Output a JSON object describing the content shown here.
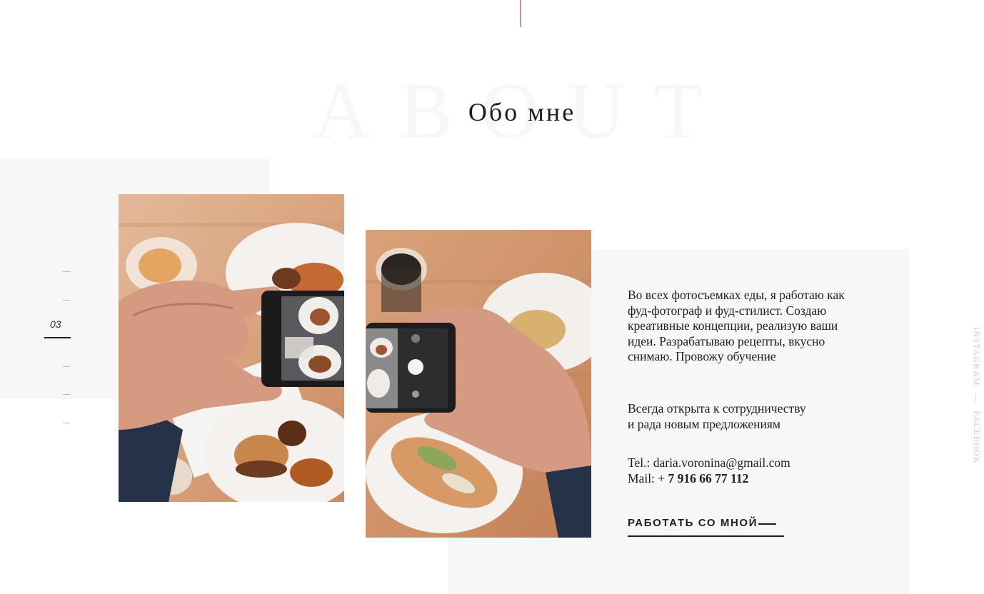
{
  "section": {
    "background_word": "ABOUT",
    "title": "Обо мне"
  },
  "pager": {
    "current": "03"
  },
  "about": {
    "paragraph_1": "Во всех фотосъемках еды, я работаю как фуд-фотограф и фуд-стилист. Создаю креативные концепции, реализую ваши идеи. Разрабатываю рецепты, вкусно снимаю. Провожу обучение",
    "paragraph_2_line_1": "Всегда открыта к сотрудничеству",
    "paragraph_2_line_2": "и рада новым предложениям",
    "contact_email_label": "Tel.:",
    "contact_email": "daria.voronina@gmail.com",
    "contact_phone_label": "Mail: +",
    "contact_phone": "7 916 66 77 112"
  },
  "cta": {
    "label": "РАБОТАТЬ СО МНОЙ"
  },
  "social": {
    "instagram": "INSTAGRAM",
    "separator": "—",
    "facebook": "FACEBOOK"
  },
  "colors": {
    "accent": "#c98fae",
    "text": "#1e1e1e",
    "panel": "#f7f7f7"
  }
}
